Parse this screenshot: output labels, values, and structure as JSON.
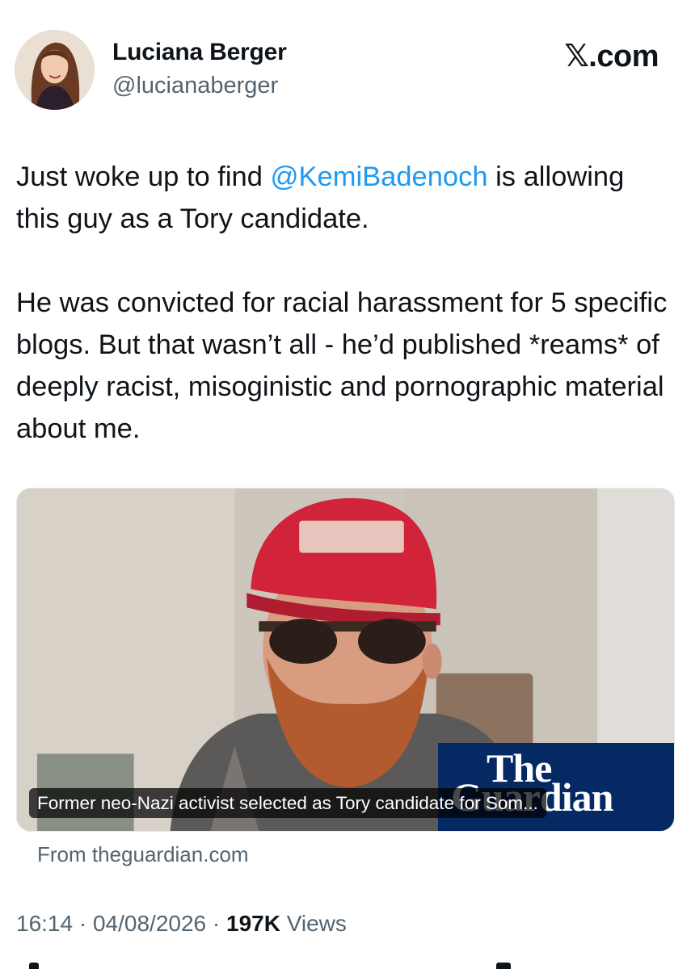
{
  "author": {
    "display_name": "Luciana Berger",
    "handle": "@lucianaberger"
  },
  "brand": "𝕏.com",
  "tweet": {
    "line1_before": "Just woke up to find ",
    "mention": "@KemiBadenoch",
    "line1_after": " is allowing this guy as a Tory candidate.",
    "paragraph2": "He was convicted for racial harassment for 5 specific blogs. But that wasn’t all - he’d published *reams* of deeply racist, misoginistic and pornographic material about me."
  },
  "card": {
    "caption": "Former neo-Nazi activist selected as Tory candidate for Som...",
    "publisher_line1": "The",
    "publisher_line2": "Guardian",
    "source": "From theguardian.com"
  },
  "meta": {
    "time": "16:14",
    "separator": "·",
    "date": "04/08/2026",
    "views_count": "197K",
    "views_label": "Views"
  },
  "colors": {
    "accent": "#1d9bf0",
    "secondary_text": "#536471",
    "guardian_blue": "#052962",
    "cap_red": "#d1233a"
  }
}
